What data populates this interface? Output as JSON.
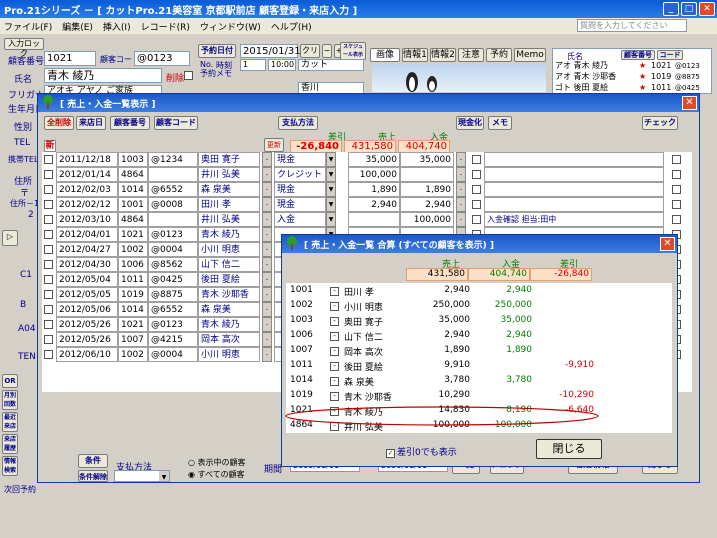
{
  "app": {
    "title": "Pro.21シリーズ － [ カットPro.21美容室  京都駅前店  顧客登録・来店入力 ]",
    "menu": [
      "ファイル(F)",
      "編集(E)",
      "挿入(I)",
      "レコード(R)",
      "ウィンドウ(W)",
      "ヘルプ(H)"
    ],
    "help_placeholder": "質問を入力してください"
  },
  "background_form": {
    "input_lock": "入力ロック",
    "customer_no_label": "顧客番号",
    "customer_no": "1021",
    "customer_code_label": "顧客コード",
    "customer_code": "@0123",
    "name_label": "氏名",
    "name": "青木 綾乃",
    "delete_label": "削除",
    "furigana_label": "フリガナ",
    "furigana": "アオキ アヤノ ご家族",
    "birthday_label": "生年月日",
    "reserve_date_btn": "予約日付",
    "reserve_date": "2015/01/31",
    "clear_btn": "クリア",
    "schedule_btn": "スケジュール表示",
    "no_label": "No.",
    "time_label": "時刻",
    "reserve_memo_label": "予約メモ",
    "no_value": "1",
    "time_value": "10:00",
    "menu_value": "カット",
    "staff_value": "香川",
    "tabs": [
      "画像",
      "情報1",
      "情報2",
      "注意",
      "予約",
      "Memo"
    ],
    "right_header_name": "氏名",
    "right_header_no": "顧客番号",
    "right_header_code": "コード",
    "right_list": [
      {
        "kana": "アオ",
        "name": "青木 綾乃",
        "no": "1021",
        "code": "@0123"
      },
      {
        "kana": "アオ",
        "name": "青木 沙耶香",
        "no": "1019",
        "code": "@8875"
      },
      {
        "kana": "ゴト",
        "name": "後田 夏絵",
        "no": "1011",
        "code": "@0425"
      }
    ],
    "side_labels": [
      "性別",
      "TEL",
      "携帯TEL",
      "住所",
      "〒",
      "住所－1",
      "2"
    ],
    "left_col_codes": [
      "C1",
      "B",
      "A04",
      "TEN"
    ],
    "left_buttons": [
      "OR",
      "月別\n回数",
      "最近\n来店",
      "来店\n履歴",
      "情報\n検索"
    ],
    "footer_label": "次回予約"
  },
  "sales_window": {
    "title": "[ 売上・入金一覧表示 ]",
    "buttons": [
      "全削除",
      "来店日",
      "顧客番号",
      "顧客コード",
      "支払方法",
      "現金化",
      "メモ",
      "チェック"
    ],
    "new_label": "新",
    "update_label": "更新",
    "totals_labels": {
      "diff": "差引",
      "sales": "売上",
      "payment": "入金"
    },
    "totals": {
      "diff": "-26,840",
      "sales": "431,580",
      "payment": "404,740"
    },
    "rows": [
      {
        "date": "2011/12/18",
        "no": "1003",
        "code": "@1234",
        "name": "奥田 寛子",
        "method": "現金",
        "sales": "35,000",
        "payment": "35,000",
        "memo": ""
      },
      {
        "date": "2012/01/14",
        "no": "4864",
        "code": "",
        "name": "井川 弘美",
        "method": "クレジット",
        "sales": "100,000",
        "payment": "",
        "memo": ""
      },
      {
        "date": "2012/02/03",
        "no": "1014",
        "code": "@6552",
        "name": "森 泉美",
        "method": "現金",
        "sales": "1,890",
        "payment": "1,890",
        "memo": ""
      },
      {
        "date": "2012/02/12",
        "no": "1001",
        "code": "@0008",
        "name": "田川 孝",
        "method": "現金",
        "sales": "2,940",
        "payment": "2,940",
        "memo": ""
      },
      {
        "date": "2012/03/10",
        "no": "4864",
        "code": "",
        "name": "井川 弘美",
        "method": "入金",
        "sales": "",
        "payment": "100,000",
        "memo": "入金確認 担当:田中"
      },
      {
        "date": "2012/04/01",
        "no": "1021",
        "code": "@0123",
        "name": "青木 綾乃",
        "method": "",
        "sales": "",
        "payment": "",
        "memo": ""
      },
      {
        "date": "2012/04/27",
        "no": "1002",
        "code": "@0004",
        "name": "小川 明恵",
        "method": "",
        "sales": "",
        "payment": "",
        "memo": ""
      },
      {
        "date": "2012/04/30",
        "no": "1006",
        "code": "@8562",
        "name": "山下 信二",
        "method": "",
        "sales": "",
        "payment": "",
        "memo": ""
      },
      {
        "date": "2012/05/04",
        "no": "1011",
        "code": "@0425",
        "name": "後田 夏絵",
        "method": "",
        "sales": "",
        "payment": "",
        "memo": ""
      },
      {
        "date": "2012/05/05",
        "no": "1019",
        "code": "@8875",
        "name": "青木 沙耶香",
        "method": "",
        "sales": "",
        "payment": "",
        "memo": ""
      },
      {
        "date": "2012/05/06",
        "no": "1014",
        "code": "@6552",
        "name": "森 泉美",
        "method": "",
        "sales": "",
        "payment": "",
        "memo": ""
      },
      {
        "date": "2012/05/26",
        "no": "1021",
        "code": "@0123",
        "name": "青木 綾乃",
        "method": "",
        "sales": "",
        "payment": "",
        "memo": ""
      },
      {
        "date": "2012/05/26",
        "no": "1007",
        "code": "@4215",
        "name": "岡本 高次",
        "method": "",
        "sales": "",
        "payment": "",
        "memo": ""
      },
      {
        "date": "2012/06/10",
        "no": "1002",
        "code": "@0004",
        "name": "小川 明恵",
        "method": "",
        "sales": "",
        "payment": "",
        "memo": ""
      }
    ],
    "filter_btn": "条件",
    "filter_clear_btn": "条件解除",
    "payment_method_label": "支払方法",
    "radio_shown": "表示中の顧客",
    "radio_all": "すべての顧客",
    "period_label": "期間",
    "period_from": "2009/01/01",
    "period_to": "2030/01/01",
    "list_btn": "一覧",
    "check_btn": "チェック",
    "cust_info_btn": "顧客情報",
    "close_btn": "閉じる"
  },
  "summary_window": {
    "title": "[ 売上・入金一覧  合算 (すべての顧客を表示) ]",
    "col_sales": "売上",
    "col_payment": "入金",
    "col_diff": "差引",
    "totals": {
      "sales": "431,580",
      "payment": "404,740",
      "diff": "-26,840"
    },
    "rows": [
      {
        "no": "1001",
        "name": "田川 孝",
        "sales": "2,940",
        "payment": "2,940",
        "diff": ""
      },
      {
        "no": "1002",
        "name": "小川 明恵",
        "sales": "250,000",
        "payment": "250,000",
        "diff": ""
      },
      {
        "no": "1003",
        "name": "奥田 寛子",
        "sales": "35,000",
        "payment": "35,000",
        "diff": ""
      },
      {
        "no": "1006",
        "name": "山下 信二",
        "sales": "2,940",
        "payment": "2,940",
        "diff": ""
      },
      {
        "no": "1007",
        "name": "岡本 高次",
        "sales": "1,890",
        "payment": "1,890",
        "diff": ""
      },
      {
        "no": "1011",
        "name": "後田 夏絵",
        "sales": "9,910",
        "payment": "",
        "diff": "-9,910"
      },
      {
        "no": "1014",
        "name": "森 泉美",
        "sales": "3,780",
        "payment": "3,780",
        "diff": ""
      },
      {
        "no": "1019",
        "name": "青木 沙耶香",
        "sales": "10,290",
        "payment": "",
        "diff": "-10,290"
      },
      {
        "no": "1021",
        "name": "青木 綾乃",
        "sales": "14,830",
        "payment": "8,190",
        "diff": "-6,640"
      },
      {
        "no": "4864",
        "name": "井川 弘美",
        "sales": "100,000",
        "payment": "100,000",
        "diff": ""
      }
    ],
    "show_zero_label": "差引0でも表示",
    "close_btn": "閉じる"
  }
}
